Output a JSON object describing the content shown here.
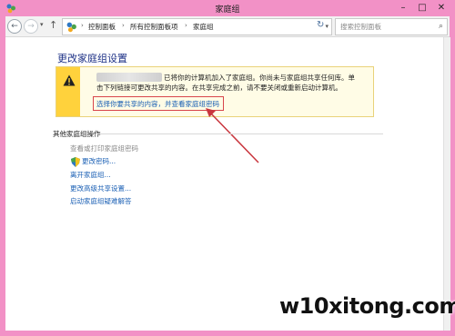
{
  "window": {
    "title": "家庭组"
  },
  "nav": {
    "back_arrow": "←",
    "forward_arrow": "→",
    "up_arrow": "↑",
    "breadcrumbs": [
      "控制面板",
      "所有控制面板项",
      "家庭组"
    ],
    "search_placeholder": "搜索控制面板"
  },
  "main": {
    "title": "更改家庭组设置",
    "warning": {
      "line1": "已将你的计算机加入了家庭组。你尚未与家庭组共享任何库。单",
      "line2": "击下列链接可更改共享的内容。在共享完成之前，请不要关闭或重新启动计算机。",
      "link": "选择你要共享的内容，并查看家庭组密码"
    },
    "other_actions": {
      "title": "其他家庭组操作",
      "items": [
        {
          "label": "查看或打印家庭组密码",
          "enabled": false
        },
        {
          "label": "更改密码...",
          "enabled": true,
          "icon": "shield-icon"
        },
        {
          "label": "离开家庭组...",
          "enabled": true
        },
        {
          "label": "更改高级共享设置...",
          "enabled": true
        },
        {
          "label": "启动家庭组疑难解答",
          "enabled": true
        }
      ]
    }
  },
  "watermark": "w10xitong.com",
  "colors": {
    "window_frame": "#f291c6",
    "title_blue": "#1e3287",
    "link_blue": "#1a5fb4",
    "warning_yellow": "#ffd23c",
    "highlight_red": "#d8454b"
  }
}
